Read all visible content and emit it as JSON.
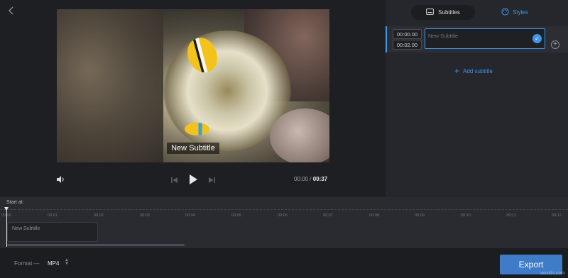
{
  "player": {
    "subtitle_overlay": "New Subtitle",
    "time_current": "00:00",
    "time_separator": "/",
    "time_total": "00:37"
  },
  "panel": {
    "tabs": [
      {
        "label": "Subtitles",
        "icon": "subtitles-icon"
      },
      {
        "label": "Styles",
        "icon": "palette-icon"
      }
    ],
    "subtitle_row": {
      "start": "00:00.00",
      "end": "00:02.00",
      "text_placeholder": "New Subtitle"
    },
    "add_subtitle_label": "Add subtitle"
  },
  "timeline": {
    "start_at_label": "Start at:",
    "ticks": [
      "00:00",
      "00:01",
      "00:02",
      "00:03",
      "00:04",
      "00:05",
      "00:06",
      "00:07",
      "00:08",
      "00:09",
      "00:10",
      "00:11",
      "00:12"
    ],
    "clip_label": "New Subtitle"
  },
  "bottom": {
    "format_label": "Format —",
    "format_value": "MP4",
    "export_label": "Export",
    "watermark": "wsxdn.com"
  },
  "colors": {
    "accent": "#3e97e8",
    "export_button": "#3e7cc8",
    "background": "#1c1d21",
    "panel": "#26272c"
  }
}
